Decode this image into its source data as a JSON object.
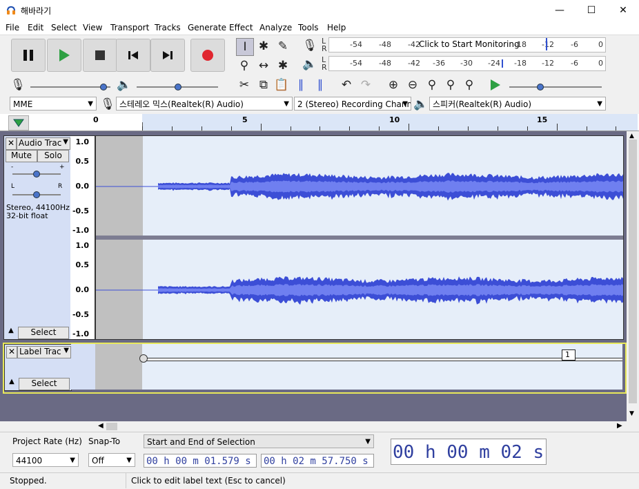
{
  "window": {
    "title": "해바라기"
  },
  "menu": [
    "File",
    "Edit",
    "Select",
    "View",
    "Transport",
    "Tracks",
    "Generate",
    "Effect",
    "Analyze",
    "Tools",
    "Help"
  ],
  "meters": {
    "record_ticks": [
      "-54",
      "-48",
      "-42",
      "-18",
      "-12",
      "-6",
      "0"
    ],
    "record_prompt": "Click to Start Monitoring",
    "play_ticks": [
      "-54",
      "-48",
      "-42",
      "-36",
      "-30",
      "-24",
      "-18",
      "-12",
      "-6",
      "0"
    ],
    "channels": [
      "L",
      "R"
    ]
  },
  "devices": {
    "host": "MME",
    "input": "스테레오 믹스(Realtek(R) Audio)",
    "channels": "2 (Stereo) Recording Chann",
    "output": "스피커(Realtek(R) Audio)"
  },
  "ruler": {
    "ticks": [
      "0",
      "5",
      "10",
      "15"
    ]
  },
  "audio_track": {
    "name": "Audio Trac",
    "mute": "Mute",
    "solo": "Solo",
    "pan_left": "L",
    "pan_right": "R",
    "info_line1": "Stereo, 44100Hz",
    "info_line2": "32-bit float",
    "select": "Select",
    "scale": [
      "1.0",
      "0.5",
      "0.0",
      "-0.5",
      "-1.0"
    ]
  },
  "label_track": {
    "name": "Label Trac",
    "select": "Select",
    "label_text": "1"
  },
  "selection_toolbar": {
    "project_rate_label": "Project Rate (Hz)",
    "project_rate_value": "44100",
    "snap_label": "Snap-To",
    "snap_value": "Off",
    "selection_mode": "Start and End of Selection",
    "start_time": "00 h 00 m 01.579 s",
    "end_time": "00 h 02 m 57.750 s",
    "audio_position": "00 h 00 m 02 s"
  },
  "status": {
    "state": "Stopped.",
    "hint": "Click to edit label text (Esc to cancel)"
  },
  "colors": {
    "waveform": "#3c4ed6",
    "waveform_rms": "#6f7ff0",
    "selection_gray": "#c0c0c0",
    "record_red": "#e0262f",
    "play_green": "#2ea043"
  }
}
